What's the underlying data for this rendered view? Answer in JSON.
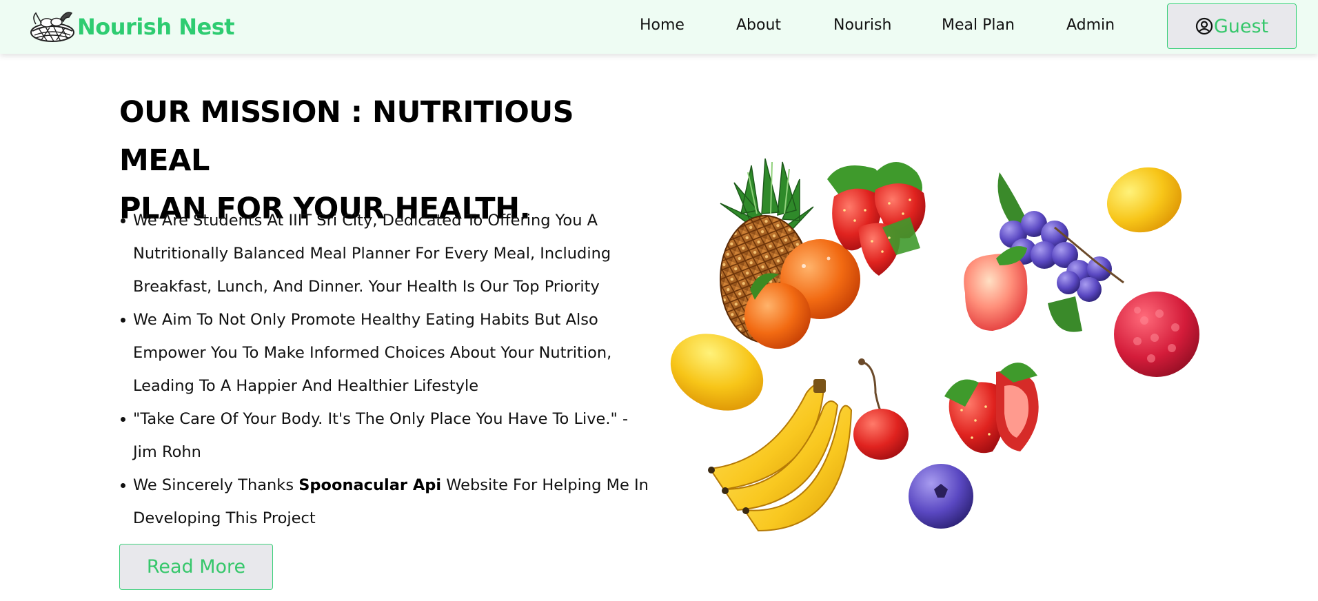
{
  "brand": {
    "name": "Nourish Nest",
    "logo_icon": "nest-logo-icon"
  },
  "nav": {
    "links": [
      "Home",
      "About",
      "Nourish",
      "Meal Plan",
      "Admin"
    ],
    "user_button": {
      "label": "Guest",
      "icon": "user-circle-icon"
    }
  },
  "mission": {
    "title_line1": "OUR MISSION : NUTRITIOUS MEAL",
    "title_line2": "PLAN FOR YOUR HEALTH.",
    "bullets": [
      "We Are Students At IIIT Sri City, Dedicated To Offering You A Nutritionally Balanced Meal Planner For Every Meal, Including Breakfast, Lunch, And Dinner. Your Health Is Our Top Priority",
      "We Aim To Not Only Promote Healthy Eating Habits But Also Empower You To Make Informed Choices About Your Nutrition, Leading To A Happier And Healthier Lifestyle",
      "\"Take Care Of Your Body. It's The Only Place You Have To Live.\" - Jim Rohn"
    ],
    "thanks": {
      "prefix": "We Sincerely Thanks ",
      "highlight": "Spoonacular Api",
      "suffix": " Website For Helping Me In Developing This Project"
    },
    "read_more": "Read More"
  },
  "colors": {
    "accent": "#2ecc71",
    "nav_bg": "#eefcf3",
    "button_bg": "#e8e8ec"
  },
  "illustration": {
    "icon": "fruits-illustration"
  }
}
